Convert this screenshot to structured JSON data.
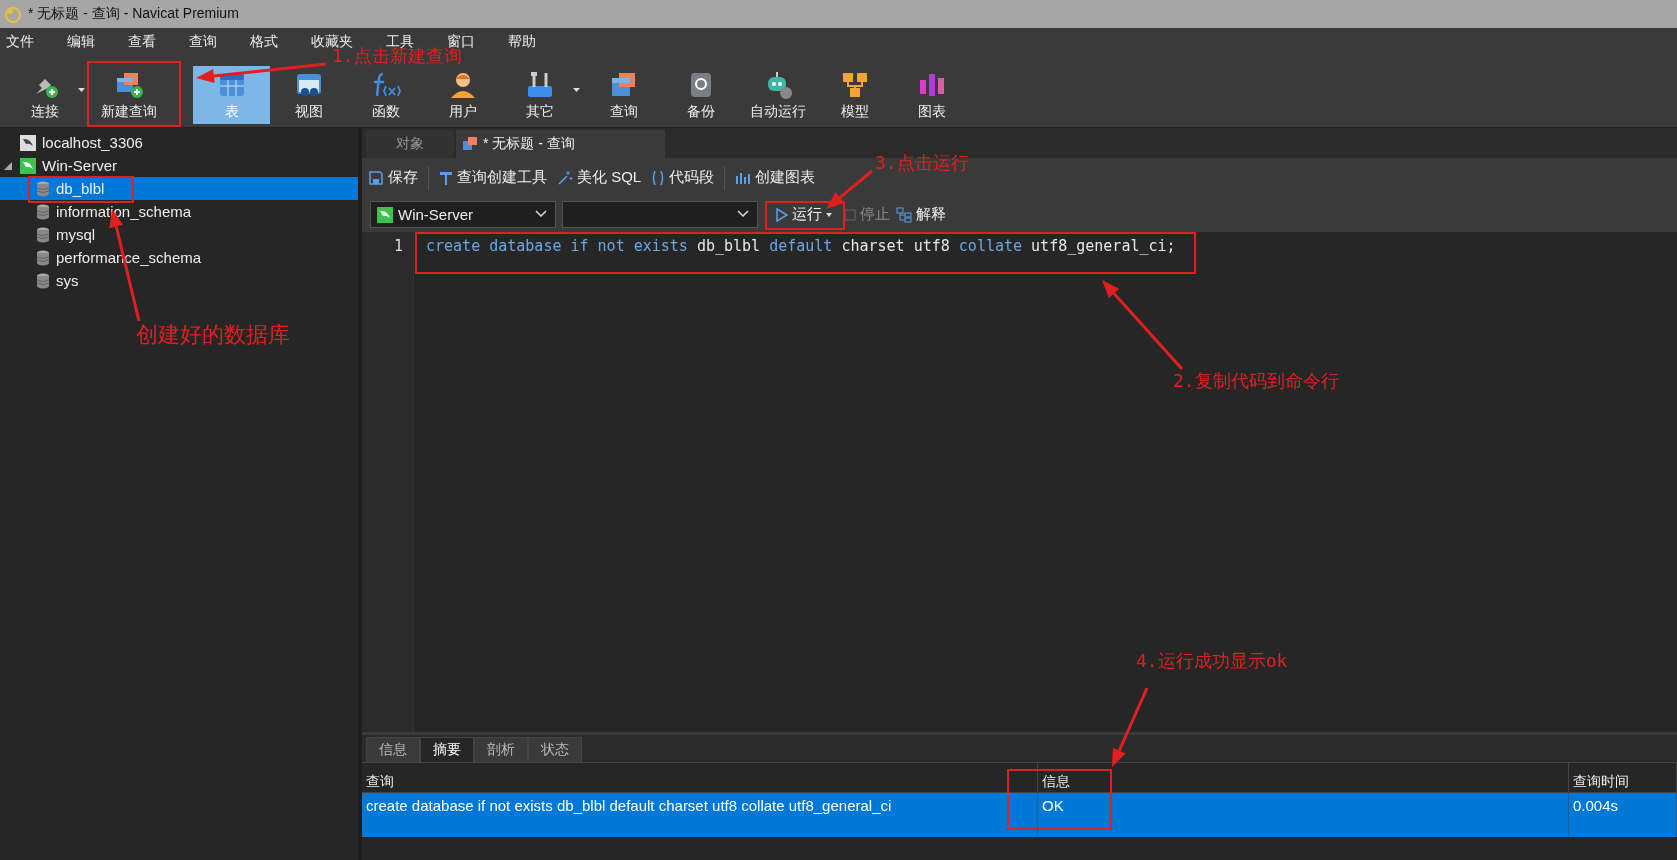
{
  "window": {
    "title": "* 无标题 - 查询 - Navicat Premium"
  },
  "menu": [
    "文件",
    "编辑",
    "查看",
    "查询",
    "格式",
    "收藏夹",
    "工具",
    "窗口",
    "帮助"
  ],
  "toolbar": [
    {
      "label": "连接",
      "selected": false,
      "has_menu": true
    },
    {
      "label": "新建查询",
      "selected": false,
      "has_menu": false
    },
    {
      "label": "表",
      "selected": true,
      "has_menu": false
    },
    {
      "label": "视图",
      "selected": false,
      "has_menu": false
    },
    {
      "label": "函数",
      "selected": false,
      "has_menu": false
    },
    {
      "label": "用户",
      "selected": false,
      "has_menu": false
    },
    {
      "label": "其它",
      "selected": false,
      "has_menu": true
    },
    {
      "label": "查询",
      "selected": false,
      "has_menu": false
    },
    {
      "label": "备份",
      "selected": false,
      "has_menu": false
    },
    {
      "label": "自动运行",
      "selected": false,
      "has_menu": false
    },
    {
      "label": "模型",
      "selected": false,
      "has_menu": false
    },
    {
      "label": "图表",
      "selected": false,
      "has_menu": false
    }
  ],
  "tree": [
    {
      "label": "localhost_3306",
      "kind": "connection",
      "expanded": false,
      "selected": false
    },
    {
      "label": "Win-Server",
      "kind": "connection",
      "expanded": true,
      "selected": false,
      "children": [
        {
          "label": "db_blbl",
          "kind": "database",
          "selected": true
        },
        {
          "label": "information_schema",
          "kind": "database",
          "selected": false
        },
        {
          "label": "mysql",
          "kind": "database",
          "selected": false
        },
        {
          "label": "performance_schema",
          "kind": "database",
          "selected": false
        },
        {
          "label": "sys",
          "kind": "database",
          "selected": false
        }
      ]
    }
  ],
  "editor_tabs": [
    {
      "label": "对象",
      "selected": false
    },
    {
      "label": "* 无标题 - 查询",
      "selected": true
    }
  ],
  "query_toolbar": [
    "保存",
    "查询创建工具",
    "美化 SQL",
    "代码段",
    "创建图表"
  ],
  "connection_select": {
    "value": "Win-Server"
  },
  "run_button": "运行",
  "stop": {
    "label": "停止",
    "disabled": true
  },
  "explain": "解释",
  "code_lines": [
    {
      "number": "1",
      "tokens": [
        {
          "text": "create",
          "kind": "keyword"
        },
        {
          "text": "database",
          "kind": "keyword"
        },
        {
          "text": "if",
          "kind": "keyword"
        },
        {
          "text": "not",
          "kind": "keyword"
        },
        {
          "text": "exists",
          "kind": "keyword"
        },
        {
          "text": "db_blbl",
          "kind": "plain"
        },
        {
          "text": "default",
          "kind": "keyword"
        },
        {
          "text": "charset",
          "kind": "plain"
        },
        {
          "text": "utf8",
          "kind": "plain"
        },
        {
          "text": "collate",
          "kind": "keyword"
        },
        {
          "text": "utf8_general_ci;",
          "kind": "plain"
        }
      ]
    }
  ],
  "result_tabs": [
    {
      "label": "信息",
      "selected": false
    },
    {
      "label": "摘要",
      "selected": true
    },
    {
      "label": "剖析",
      "selected": false
    },
    {
      "label": "状态",
      "selected": false
    }
  ],
  "result_table": {
    "columns": [
      "查询",
      "信息",
      "查询时间"
    ],
    "rows": [
      {
        "cells": [
          "create database if not exists db_blbl default charset utf8 collate utf8_general_ci",
          "OK",
          "0.004s"
        ],
        "selected": true
      }
    ]
  },
  "annotations": [
    "1.点击新建查询",
    "创建好的数据库",
    "3.点击运行",
    "2.复制代码到命令行",
    "4.运行成功显示ok"
  ]
}
